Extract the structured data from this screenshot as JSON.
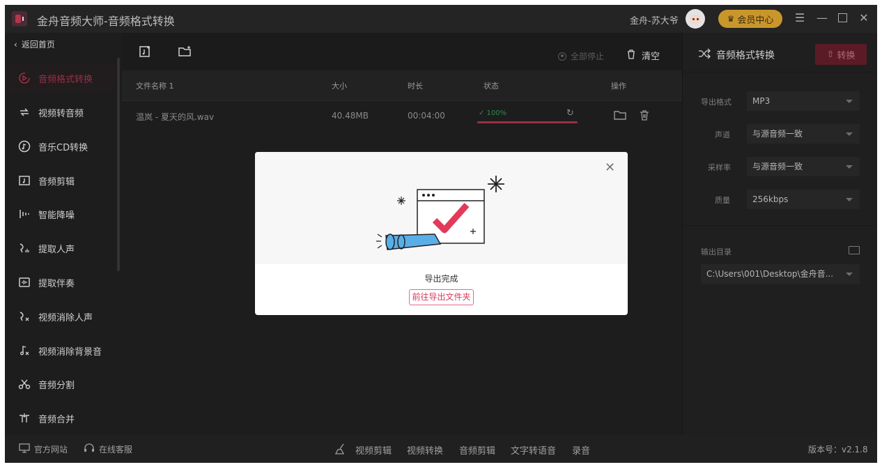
{
  "app": {
    "title": "金舟音频大师-音频格式转换",
    "username": "金舟-苏大爷",
    "vip_label": "会员中心"
  },
  "sidebar": {
    "back_label": "返回首页",
    "items": [
      {
        "label": "音频格式转换",
        "icon": "audio-convert-icon"
      },
      {
        "label": "视频转音频",
        "icon": "video-to-audio-icon"
      },
      {
        "label": "音乐CD转换",
        "icon": "cd-icon"
      },
      {
        "label": "音频剪辑",
        "icon": "audio-cut-icon"
      },
      {
        "label": "智能降噪",
        "icon": "denoise-icon"
      },
      {
        "label": "提取人声",
        "icon": "vocal-icon"
      },
      {
        "label": "提取伴奏",
        "icon": "accompaniment-icon"
      },
      {
        "label": "视频消除人声",
        "icon": "remove-vocal-icon"
      },
      {
        "label": "视频消除背景音",
        "icon": "remove-bgm-icon"
      },
      {
        "label": "音频分割",
        "icon": "scissors-icon"
      },
      {
        "label": "音频合并",
        "icon": "merge-icon"
      }
    ]
  },
  "toolbar": {
    "stop_all_label": "全部停止",
    "clear_label": "清空"
  },
  "table": {
    "columns": [
      "文件名称 1",
      "大小",
      "时长",
      "状态",
      "操作"
    ],
    "rows": [
      {
        "name": "温岚 - 夏天的风.wav",
        "size": "40.48MB",
        "duration": "00:04:00",
        "status": "✓ 100%",
        "progress": 1.0
      }
    ]
  },
  "right_panel": {
    "title": "音频格式转换",
    "convert_label": "转换",
    "fields": [
      {
        "label": "导出格式",
        "value": "MP3"
      },
      {
        "label": "声道",
        "value": "与源音频一致"
      },
      {
        "label": "采样率",
        "value": "与源音频一致"
      },
      {
        "label": "质量",
        "value": "256kbps"
      }
    ],
    "output_label": "输出目录",
    "output_path": "C:\\Users\\001\\Desktop\\金舟音..."
  },
  "bottom": {
    "website": "官方网站",
    "support": "在线客服",
    "links": [
      "视频剪辑",
      "视频转换",
      "音频剪辑",
      "文字转语音",
      "录音"
    ],
    "version": "版本号：v2.1.8"
  },
  "modal": {
    "message": "导出完成",
    "button_label": "前往导出文件夹"
  },
  "colors": {
    "accent": "#9a2f44",
    "success": "#2f8a4f",
    "vip": "#c9962c",
    "modal_button": "#d63a5c"
  }
}
